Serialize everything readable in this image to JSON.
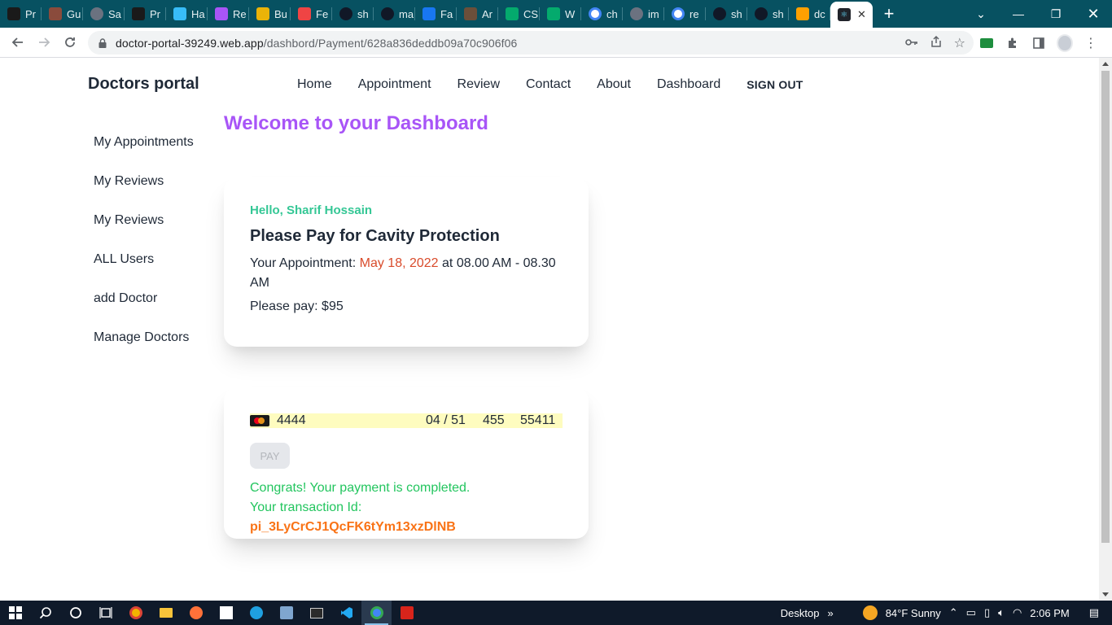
{
  "browser": {
    "tabs": [
      {
        "title": "Pr",
        "icon": "dark-square-icon",
        "color": "#1a1a1a"
      },
      {
        "title": "Gu",
        "icon": "photo-icon",
        "color": "#8a4b3c"
      },
      {
        "title": "Sa",
        "icon": "globe-icon",
        "color": "#6b7280"
      },
      {
        "title": "Pr",
        "icon": "dark-square-icon",
        "color": "#1a1a1a"
      },
      {
        "title": "Ha",
        "icon": "tailwind-icon",
        "color": "#38bdf8"
      },
      {
        "title": "Re",
        "icon": "react-icon",
        "color": "#a855f7"
      },
      {
        "title": "Bu",
        "icon": "flower-icon",
        "color": "#eab308"
      },
      {
        "title": "Fe",
        "icon": "arrow-icon",
        "color": "#ef4444"
      },
      {
        "title": "sh",
        "icon": "github-icon",
        "color": "#111827"
      },
      {
        "title": "ma",
        "icon": "github-icon",
        "color": "#111827"
      },
      {
        "title": "Fa",
        "icon": "facebook-icon",
        "color": "#1877f2"
      },
      {
        "title": "Ar",
        "icon": "avatar-icon",
        "color": "#6b4f3a"
      },
      {
        "title": "CS",
        "icon": "w3-icon",
        "color": "#04aa6d"
      },
      {
        "title": "W",
        "icon": "w3-icon",
        "color": "#04aa6d"
      },
      {
        "title": "ch",
        "icon": "google-icon",
        "color": "#ffffff"
      },
      {
        "title": "im",
        "icon": "globe-icon",
        "color": "#6b7280"
      },
      {
        "title": "re",
        "icon": "google-icon",
        "color": "#ffffff"
      },
      {
        "title": "sh",
        "icon": "github-icon",
        "color": "#111827"
      },
      {
        "title": "sh",
        "icon": "github-icon",
        "color": "#111827"
      },
      {
        "title": "dc",
        "icon": "firebase-icon",
        "color": "#ffa000"
      }
    ],
    "active_tab_icon": "react-icon",
    "url_host": "doctor-portal-39249.web.app",
    "url_path": "/dashbord/Payment/628a836deddb09a70c906f06"
  },
  "site": {
    "brand": "Doctors portal",
    "nav": [
      "Home",
      "Appointment",
      "Review",
      "Contact",
      "About",
      "Dashboard"
    ],
    "signout": "SIGN OUT"
  },
  "sidebar": {
    "items": [
      "My Appointments",
      "My Reviews",
      "My Reviews",
      "ALL Users",
      "add Doctor",
      "Manage Doctors"
    ]
  },
  "dashboard": {
    "welcome": "Welcome to your Dashboard"
  },
  "appointment_card": {
    "hello": "Hello, Sharif Hossain",
    "title": "Please Pay for Cavity Protection",
    "appt_prefix": "Your Appointment: ",
    "appt_date": "May 18, 2022",
    "appt_suffix": " at 08.00 AM - 08.30 AM",
    "pay_text": "Please pay: $95"
  },
  "payment_card": {
    "card_number": "4444",
    "expiry": "04 / 51",
    "cvc": "455",
    "zip": "55411",
    "pay_button": "PAY",
    "congrats": "Congrats! Your payment is completed.",
    "txn_label": "Your transaction Id: ",
    "txn_id": "pi_3LyCrCJ1QcFK6tYm13xzDlNB"
  },
  "taskbar": {
    "desktop_label": "Desktop",
    "weather": "84°F  Sunny",
    "time": "2:06 PM"
  },
  "colors": {
    "tabstrip": "#075161",
    "welcome": "#a855f7",
    "hello": "#34c795",
    "date": "#d94b2b",
    "success": "#22c55e",
    "txn_id": "#f97316",
    "card_field_bg": "#fefcbf"
  }
}
